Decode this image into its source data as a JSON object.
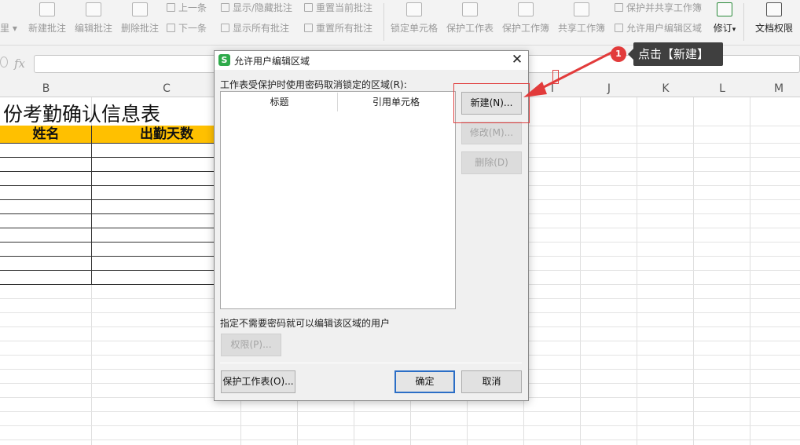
{
  "ribbon": {
    "left_label": "里 ▾",
    "new_comment": "新建批注",
    "edit_comment": "编辑批注",
    "delete_comment": "删除批注",
    "prev": "上一条",
    "next": "下一条",
    "show_hide_comment": "显示/隐藏批注",
    "show_all_comments": "显示所有批注",
    "reset_current_comment": "重置当前批注",
    "reset_all_comments": "重置所有批注",
    "lock_cell": "锁定单元格",
    "protect_sheet": "保护工作表",
    "protect_workbook": "保护工作簿",
    "share_workbook": "共享工作簿",
    "protect_share_workbook": "保护并共享工作簿",
    "allow_edit_ranges": "允许用户编辑区域",
    "revise": "修订",
    "revise_caret": "▾",
    "doc_permission": "文档权限"
  },
  "formula_bar": {
    "fx_label": "fx",
    "value": ""
  },
  "columns": [
    "B",
    "C",
    "I",
    "J",
    "K",
    "L",
    "M"
  ],
  "sheet": {
    "title": "份考勤确认信息表",
    "header_name": "姓名",
    "header_days": "出勤天数"
  },
  "dialog": {
    "title": "允许用户编辑区域",
    "app_icon_letter": "S",
    "close_glyph": "✕",
    "ranges_label": "工作表受保护时使用密码取消锁定的区域(R):",
    "col_title": "标题",
    "col_ref": "引用单元格",
    "btn_new": "新建(N)...",
    "btn_modify": "修改(M)...",
    "btn_delete": "删除(D)",
    "users_label": "指定不需要密码就可以编辑该区域的用户",
    "btn_permission": "权限(P)...",
    "btn_protect_sheet": "保护工作表(O)...",
    "btn_ok": "确定",
    "btn_cancel": "取消"
  },
  "annotation": {
    "step_number": "1",
    "tooltip": "点击【新建】",
    "color": "#e23b3b"
  },
  "colors": {
    "header_fill": "#ffc000",
    "app_icon": "#2eaa4a",
    "default_button_border": "#2b6ec6"
  }
}
